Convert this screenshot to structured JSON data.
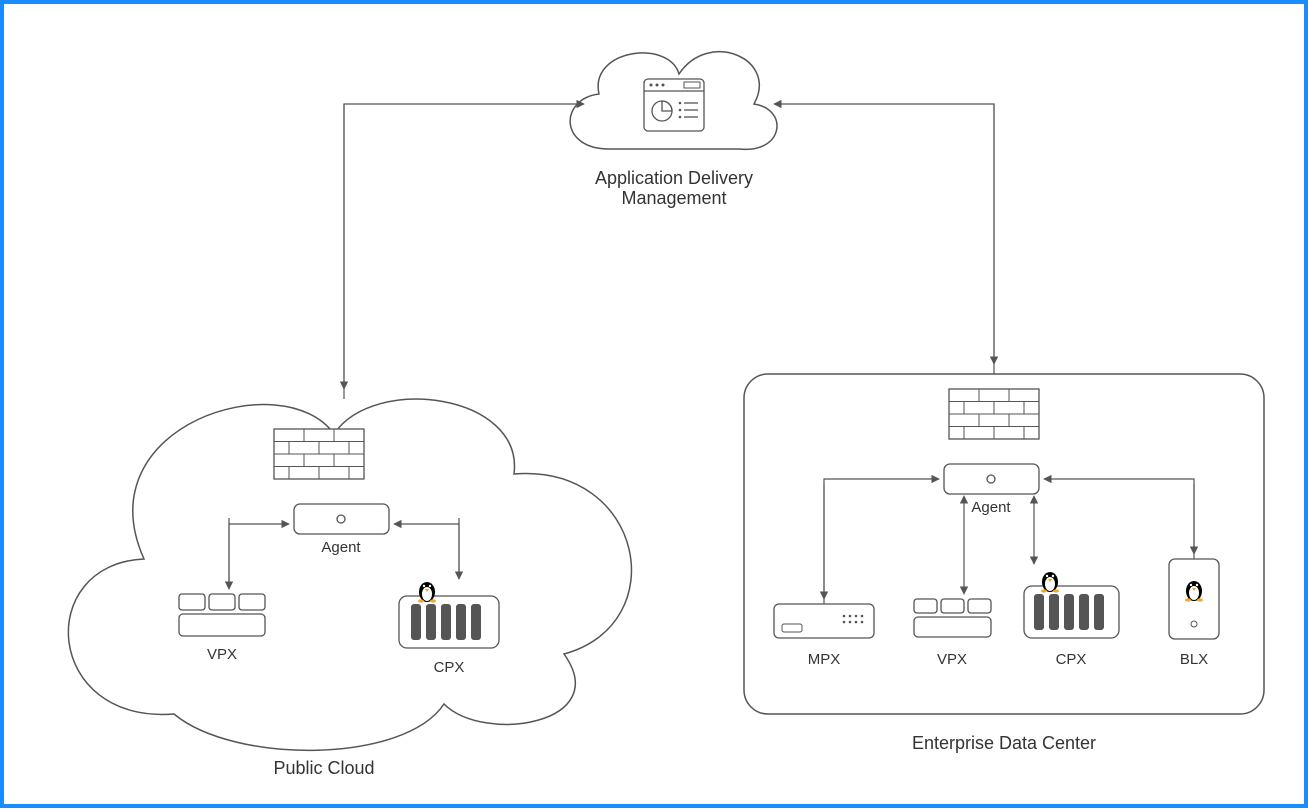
{
  "diagram": {
    "title": "Application Delivery Management",
    "left_region": {
      "label": "Public Cloud",
      "agent_label": "Agent",
      "devices": {
        "vpx": "VPX",
        "cpx": "CPX"
      }
    },
    "right_region": {
      "label": "Enterprise Data Center",
      "agent_label": "Agent",
      "devices": {
        "mpx": "MPX",
        "vpx": "VPX",
        "cpx": "CPX",
        "blx": "BLX"
      }
    }
  }
}
